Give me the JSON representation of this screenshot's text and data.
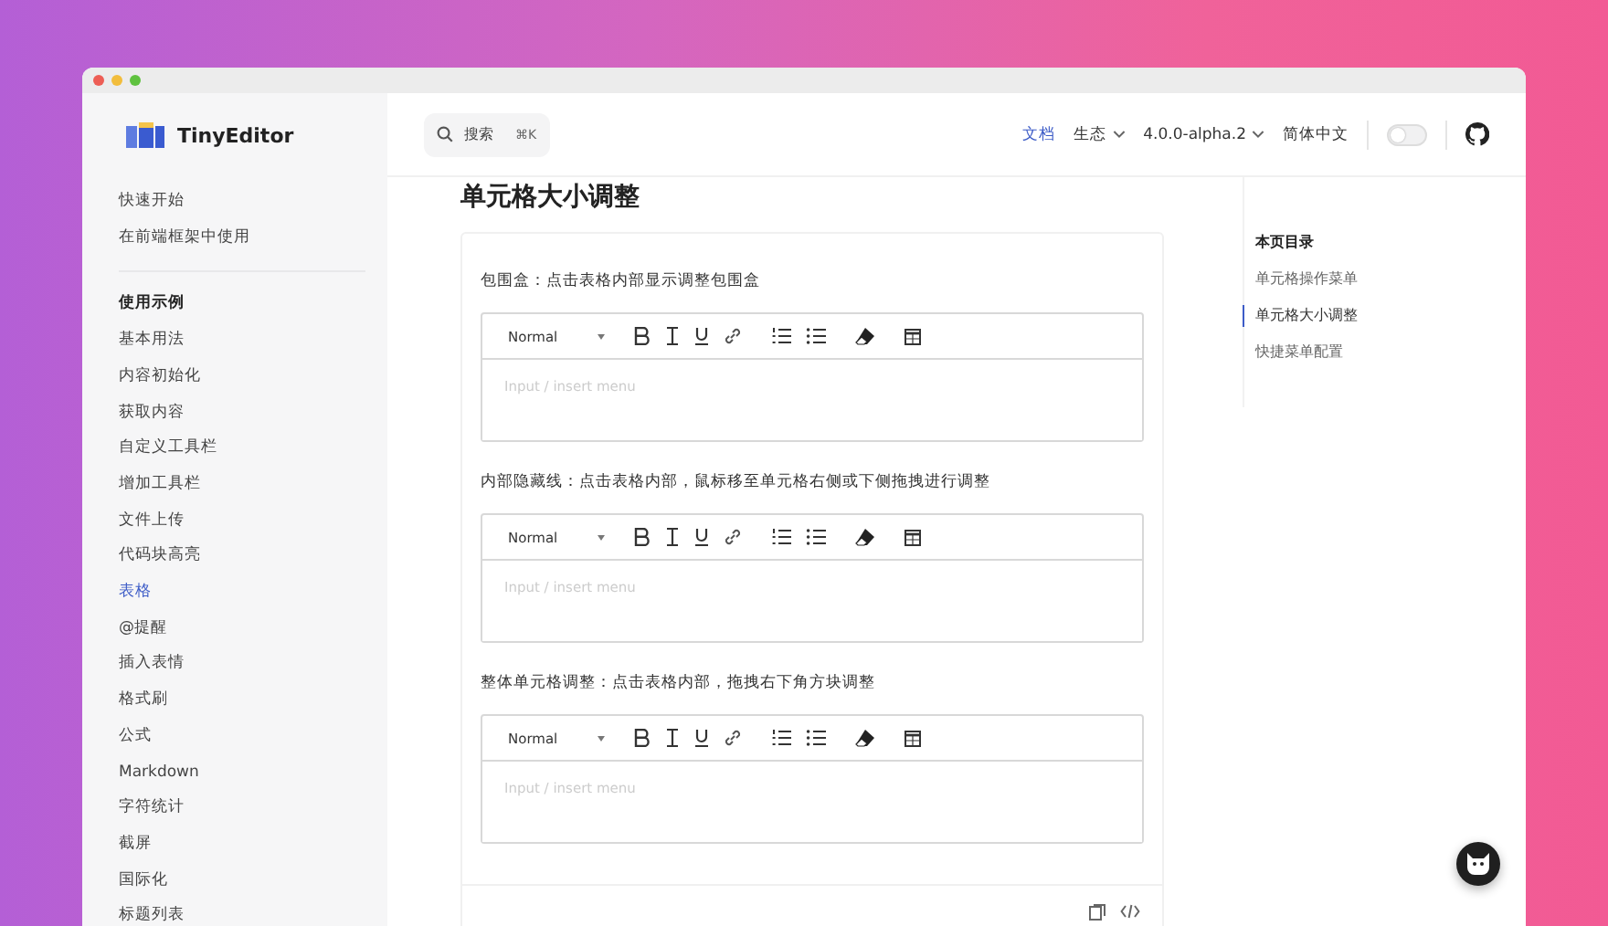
{
  "brand": {
    "name": "TinyEditor"
  },
  "header": {
    "search": {
      "label": "搜索",
      "shortcut": "⌘K"
    },
    "nav": [
      {
        "label": "文档",
        "selected": true,
        "dropdown": false
      },
      {
        "label": "生态",
        "selected": false,
        "dropdown": true
      },
      {
        "label": "4.0.0-alpha.2",
        "selected": false,
        "dropdown": true
      },
      {
        "label": "简体中文",
        "selected": false,
        "dropdown": false
      }
    ],
    "theme_toggle": {
      "on": false
    }
  },
  "sidebar": {
    "groups": [
      {
        "items": [
          {
            "label": "快速开始",
            "selected": false
          },
          {
            "label": "在前端框架中使用",
            "selected": false
          }
        ]
      },
      {
        "title": "使用示例",
        "items": [
          {
            "label": "基本用法",
            "selected": false
          },
          {
            "label": "内容初始化",
            "selected": false
          },
          {
            "label": "获取内容",
            "selected": false
          },
          {
            "label": "自定义工具栏",
            "selected": false
          },
          {
            "label": "增加工具栏",
            "selected": false
          },
          {
            "label": "文件上传",
            "selected": false
          },
          {
            "label": "代码块高亮",
            "selected": false
          },
          {
            "label": "表格",
            "selected": true
          },
          {
            "label": "@提醒",
            "selected": false
          },
          {
            "label": "插入表情",
            "selected": false
          },
          {
            "label": "格式刷",
            "selected": false
          },
          {
            "label": "公式",
            "selected": false
          },
          {
            "label": "Markdown",
            "selected": false
          },
          {
            "label": "字符统计",
            "selected": false
          },
          {
            "label": "截屏",
            "selected": false
          },
          {
            "label": "国际化",
            "selected": false
          },
          {
            "label": "标题列表",
            "selected": false
          }
        ]
      }
    ]
  },
  "page": {
    "title": "单元格大小调整",
    "demos": [
      {
        "label": "包围盒：点击表格内部显示调整包围盒",
        "format": "Normal",
        "placeholder": "Input / insert menu"
      },
      {
        "label": "内部隐藏线：点击表格内部，鼠标移至单元格右侧或下侧拖拽进行调整",
        "format": "Normal",
        "placeholder": "Input / insert menu"
      },
      {
        "label": "整体单元格调整：点击表格内部，拖拽右下角方块调整",
        "format": "Normal",
        "placeholder": "Input / insert menu"
      }
    ]
  },
  "toc": {
    "title": "本页目录",
    "items": [
      {
        "label": "单元格操作菜单",
        "selected": false
      },
      {
        "label": "单元格大小调整",
        "selected": true
      },
      {
        "label": "快捷菜单配置",
        "selected": false
      }
    ]
  }
}
